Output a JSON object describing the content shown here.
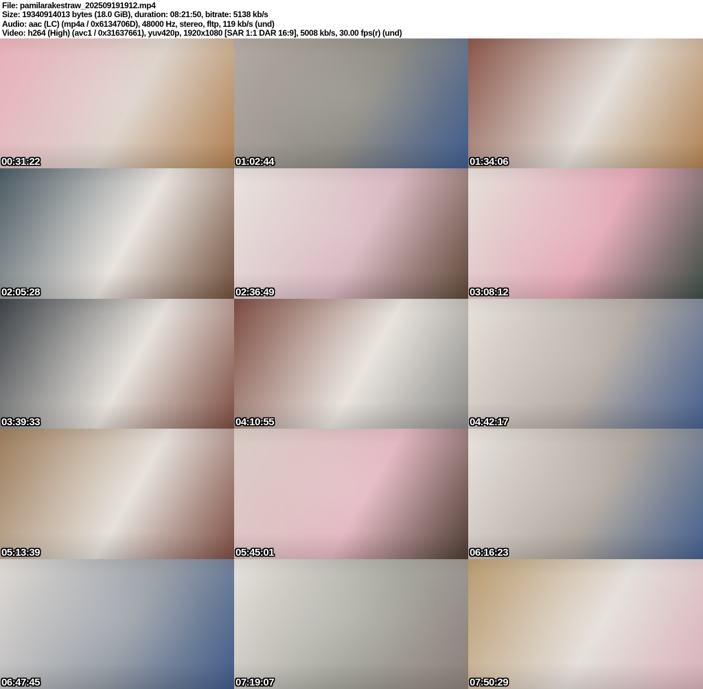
{
  "header": {
    "file_line": "File: pamilarakestraw_202509191912.mp4",
    "size_line": "Size: 19340914013 bytes (18.0 GiB), duration: 08:21:50, bitrate: 5138 kb/s",
    "audio_line": "Audio: aac (LC) (mp4a / 0x6134706D), 48000 Hz, stereo, fltp, 119 kb/s (und)",
    "video_line": "Video: h264 (High) (avc1 / 0x31637661), yuv420p, 1920x1080 [SAR 1:1 DAR 16:9], 5008 kb/s, 30.00 fps(r) (und)",
    "background_color": "#ffffff",
    "text_color": "#000000"
  },
  "grid": {
    "columns": 3,
    "rows": 5
  },
  "timestamp_style": {
    "text_color": "#ffffff",
    "outline_color": "#000000"
  },
  "thumbnails": [
    {
      "timestamp": "00:31:22",
      "colors": [
        "#e9b0ba",
        "#ddd3cb",
        "#b0804f"
      ]
    },
    {
      "timestamp": "01:02:44",
      "colors": [
        "#b3aaa3",
        "#8f8d86",
        "#3f5c8e"
      ]
    },
    {
      "timestamp": "01:34:06",
      "colors": [
        "#8a564a",
        "#e2ddd7",
        "#b08253"
      ]
    },
    {
      "timestamp": "02:05:28",
      "colors": [
        "#4a5a62",
        "#e8e3de",
        "#6f4e3a"
      ]
    },
    {
      "timestamp": "02:36:49",
      "colors": [
        "#e9e4df",
        "#d9b9c2",
        "#5c4736"
      ]
    },
    {
      "timestamp": "03:08:12",
      "colors": [
        "#e5e0da",
        "#e4a8b6",
        "#3c4c44"
      ]
    },
    {
      "timestamp": "03:39:33",
      "colors": [
        "#3e4348",
        "#e6e1db",
        "#7c4c41"
      ]
    },
    {
      "timestamp": "04:10:55",
      "colors": [
        "#7d4c41",
        "#e8e3dd",
        "#8b8b89"
      ]
    },
    {
      "timestamp": "04:42:17",
      "colors": [
        "#e7e2dc",
        "#b5aca4",
        "#466190"
      ]
    },
    {
      "timestamp": "05:13:39",
      "colors": [
        "#9c7c5a",
        "#e5e0da",
        "#7c4c41"
      ]
    },
    {
      "timestamp": "05:45:01",
      "colors": [
        "#d9cdc5",
        "#e4b9c3",
        "#4c3c31"
      ]
    },
    {
      "timestamp": "06:16:23",
      "colors": [
        "#e8e3de",
        "#b0a89f",
        "#44608e"
      ]
    },
    {
      "timestamp": "06:47:45",
      "colors": [
        "#dfdad5",
        "#9aa0a8",
        "#3f5a88"
      ]
    },
    {
      "timestamp": "07:19:07",
      "colors": [
        "#e6e1dc",
        "#a9a9a1",
        "#8b8179"
      ]
    },
    {
      "timestamp": "07:50:29",
      "colors": [
        "#ba9b6f",
        "#e4dfda",
        "#d9b1bb"
      ]
    }
  ]
}
